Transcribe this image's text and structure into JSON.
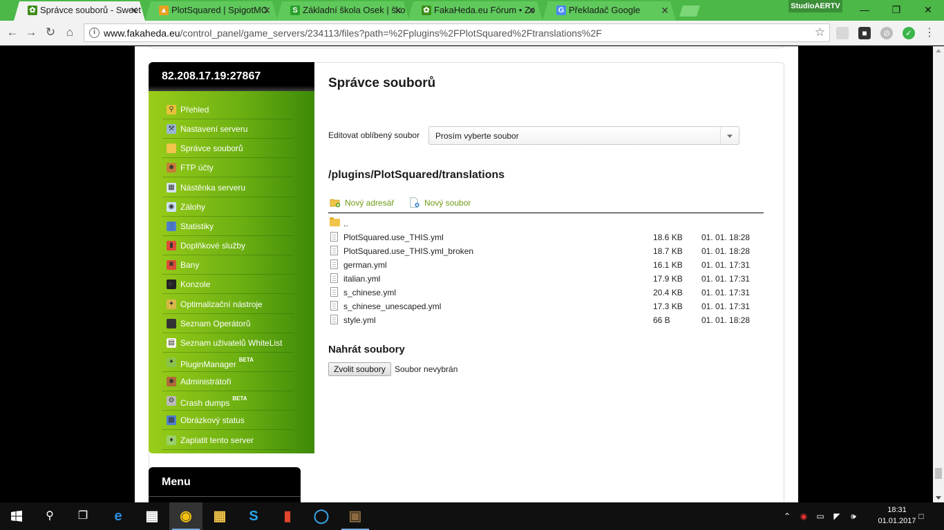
{
  "browser": {
    "tabs": [
      {
        "title": "Správce souborů - Sweet",
        "icon": "leaf-favicon",
        "color": "#3e8e19",
        "active": true
      },
      {
        "title": "PlotSquared | SpigotMC",
        "icon": "faucet-favicon",
        "color": "#e8a020",
        "active": false
      },
      {
        "title": "Základní škola Osek | ško",
        "icon": "s-favicon",
        "color": "#2aa02a",
        "active": false
      },
      {
        "title": "FakaHeda.eu Fórum • Zo",
        "icon": "leaf-favicon",
        "color": "#3e8e19",
        "active": false
      },
      {
        "title": "Překladač Google",
        "icon": "translate-favicon",
        "color": "#4a8af4",
        "active": false
      }
    ],
    "profile_name": "StudioAERTV",
    "url_host": "www.fakaheda.eu",
    "url_path": "/control_panel/game_servers/234113/files?path=%2Fplugins%2FPlotSquared%2Ftranslations%2F",
    "theme_color": "#4bb847"
  },
  "sidebar": {
    "server_address": "82.208.17.19:27867",
    "items": [
      {
        "label": "Přehled",
        "icon": "magnifier-icon",
        "badge": ""
      },
      {
        "label": "Nastavení serveru",
        "icon": "wrench-icon",
        "badge": ""
      },
      {
        "label": "Správce souborů",
        "icon": "folder-icon",
        "badge": ""
      },
      {
        "label": "FTP účty",
        "icon": "users-icon",
        "badge": ""
      },
      {
        "label": "Nástěnka serveru",
        "icon": "board-icon",
        "badge": ""
      },
      {
        "label": "Zálohy",
        "icon": "disc-icon",
        "badge": ""
      },
      {
        "label": "Statistiky",
        "icon": "chart-icon",
        "badge": ""
      },
      {
        "label": "Doplňkové služby",
        "icon": "gift-icon",
        "badge": ""
      },
      {
        "label": "Bany",
        "icon": "ban-icon",
        "badge": ""
      },
      {
        "label": "Konzole",
        "icon": "terminal-icon",
        "badge": ""
      },
      {
        "label": "Optimalizační nástroje",
        "icon": "wand-icon",
        "badge": ""
      },
      {
        "label": "Seznam Operátorů",
        "icon": "operator-icon",
        "badge": ""
      },
      {
        "label": "Seznam uživatelů WhiteList",
        "icon": "clipboard-icon",
        "badge": ""
      },
      {
        "label": "PluginManager",
        "icon": "puzzle-icon",
        "badge": "BETA"
      },
      {
        "label": "Administrátoři",
        "icon": "admin-icon",
        "badge": ""
      },
      {
        "label": "Crash dumps",
        "icon": "gear-icon",
        "badge": "BETA"
      },
      {
        "label": "Obrázkový status",
        "icon": "image-icon",
        "badge": ""
      },
      {
        "label": "Zaplatit tento server",
        "icon": "payment-icon",
        "badge": ""
      }
    ],
    "menu_title": "Menu"
  },
  "main": {
    "title": "Správce souborů",
    "favorite_label": "Editovat oblíbený soubor",
    "favorite_selected": "Prosím vyberte soubor",
    "path": "/plugins/PlotSquared/translations",
    "new_folder": "Nový adresář",
    "new_file": "Nový soubor",
    "parent_dir": "..",
    "files": [
      {
        "name": "PlotSquared.use_THIS.yml",
        "size": "18.6 KB",
        "date": "01. 01. 18:28"
      },
      {
        "name": "PlotSquared.use_THIS.yml_broken",
        "size": "18.7 KB",
        "date": "01. 01. 18:28"
      },
      {
        "name": "german.yml",
        "size": "16.1 KB",
        "date": "01. 01. 17:31"
      },
      {
        "name": "italian.yml",
        "size": "17.9 KB",
        "date": "01. 01. 17:31"
      },
      {
        "name": "s_chinese.yml",
        "size": "20.4 KB",
        "date": "01. 01. 17:31"
      },
      {
        "name": "s_chinese_unescaped.yml",
        "size": "17.3 KB",
        "date": "01. 01. 17:31"
      },
      {
        "name": "style.yml",
        "size": "66 B",
        "date": "01. 01. 18:28"
      }
    ],
    "upload_title": "Nahrát soubory",
    "choose_files": "Zvolit soubory",
    "no_file": "Soubor nevybrán",
    "accent_color": "#6f9a14"
  },
  "taskbar": {
    "apps": [
      "edge-icon",
      "store-icon",
      "chrome-icon",
      "explorer-icon",
      "skype-icon",
      "app-red-icon",
      "app-blue-icon",
      "minecraft-icon"
    ],
    "time": "18:31",
    "date": "01.01.2017"
  }
}
